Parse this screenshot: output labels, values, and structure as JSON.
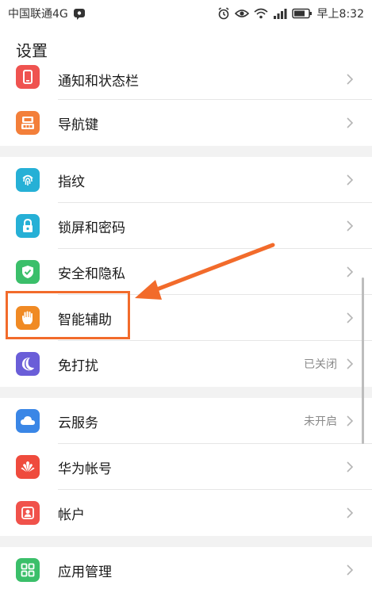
{
  "status_bar": {
    "carrier": "中国联通4G",
    "time": "早上8:32",
    "icons": [
      "message-icon",
      "alarm-icon",
      "eye-icon",
      "wifi-icon",
      "signal-icon",
      "battery-icon"
    ]
  },
  "header": {
    "title": "设置"
  },
  "groups": [
    {
      "items": [
        {
          "label": "通知和状态栏",
          "value": "",
          "icon": "notification-icon",
          "color": "#ef5350"
        },
        {
          "label": "导航键",
          "value": "",
          "icon": "navigation-key-icon",
          "color": "#f37f3a"
        }
      ]
    },
    {
      "items": [
        {
          "label": "指纹",
          "value": "",
          "icon": "fingerprint-icon",
          "color": "#26b0d6"
        },
        {
          "label": "锁屏和密码",
          "value": "",
          "icon": "lock-icon",
          "color": "#26b0d6"
        },
        {
          "label": "安全和隐私",
          "value": "",
          "icon": "shield-icon",
          "color": "#3bbf6a"
        },
        {
          "label": "智能辅助",
          "value": "",
          "icon": "hand-icon",
          "color": "#f08a24"
        },
        {
          "label": "免打扰",
          "value": "已关闭",
          "icon": "moon-icon",
          "color": "#6a5ed8"
        }
      ]
    },
    {
      "items": [
        {
          "label": "云服务",
          "value": "未开启",
          "icon": "cloud-icon",
          "color": "#3a86e6"
        },
        {
          "label": "华为帐号",
          "value": "",
          "icon": "huawei-icon",
          "color": "#ef4b3d"
        },
        {
          "label": "帐户",
          "value": "",
          "icon": "account-icon",
          "color": "#f0524b"
        }
      ]
    },
    {
      "items": [
        {
          "label": "应用管理",
          "value": "",
          "icon": "apps-icon",
          "color": "#3bbf6a"
        }
      ]
    }
  ],
  "annotation": {
    "color": "#f26b2b",
    "highlighted_item": "智能辅助"
  }
}
